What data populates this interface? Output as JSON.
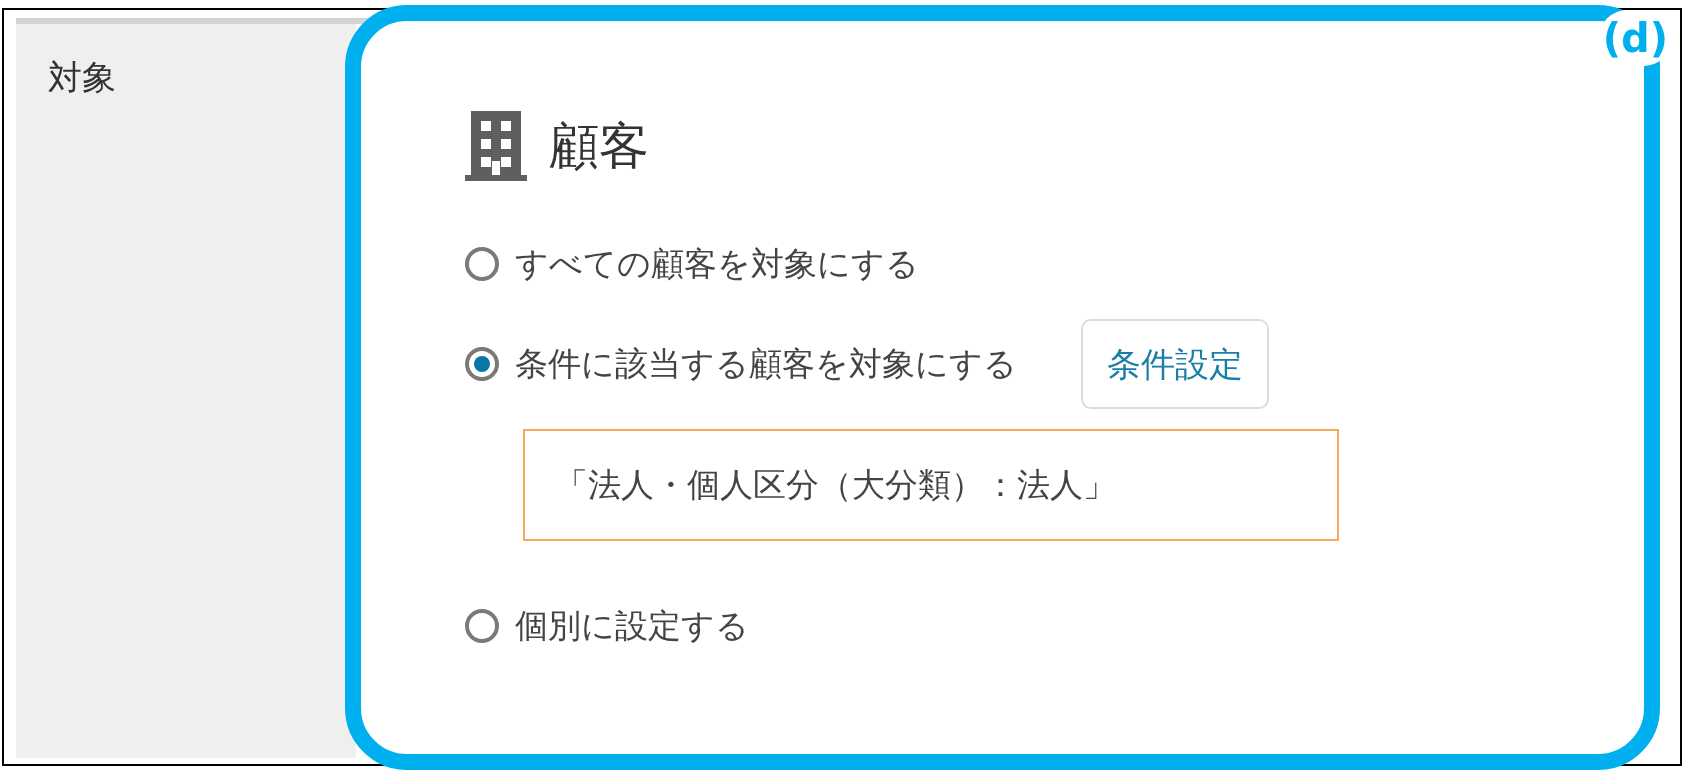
{
  "field_label": "対象",
  "section": {
    "title": "顧客"
  },
  "options": [
    {
      "label": "すべての顧客を対象にする",
      "selected": false
    },
    {
      "label": "条件に該当する顧客を対象にする",
      "selected": true,
      "button": "条件設定",
      "condition": "「法人・個人区分（大分類）：法人」"
    },
    {
      "label": "個別に設定する",
      "selected": false
    }
  ],
  "annotation": {
    "label": "(d)"
  }
}
